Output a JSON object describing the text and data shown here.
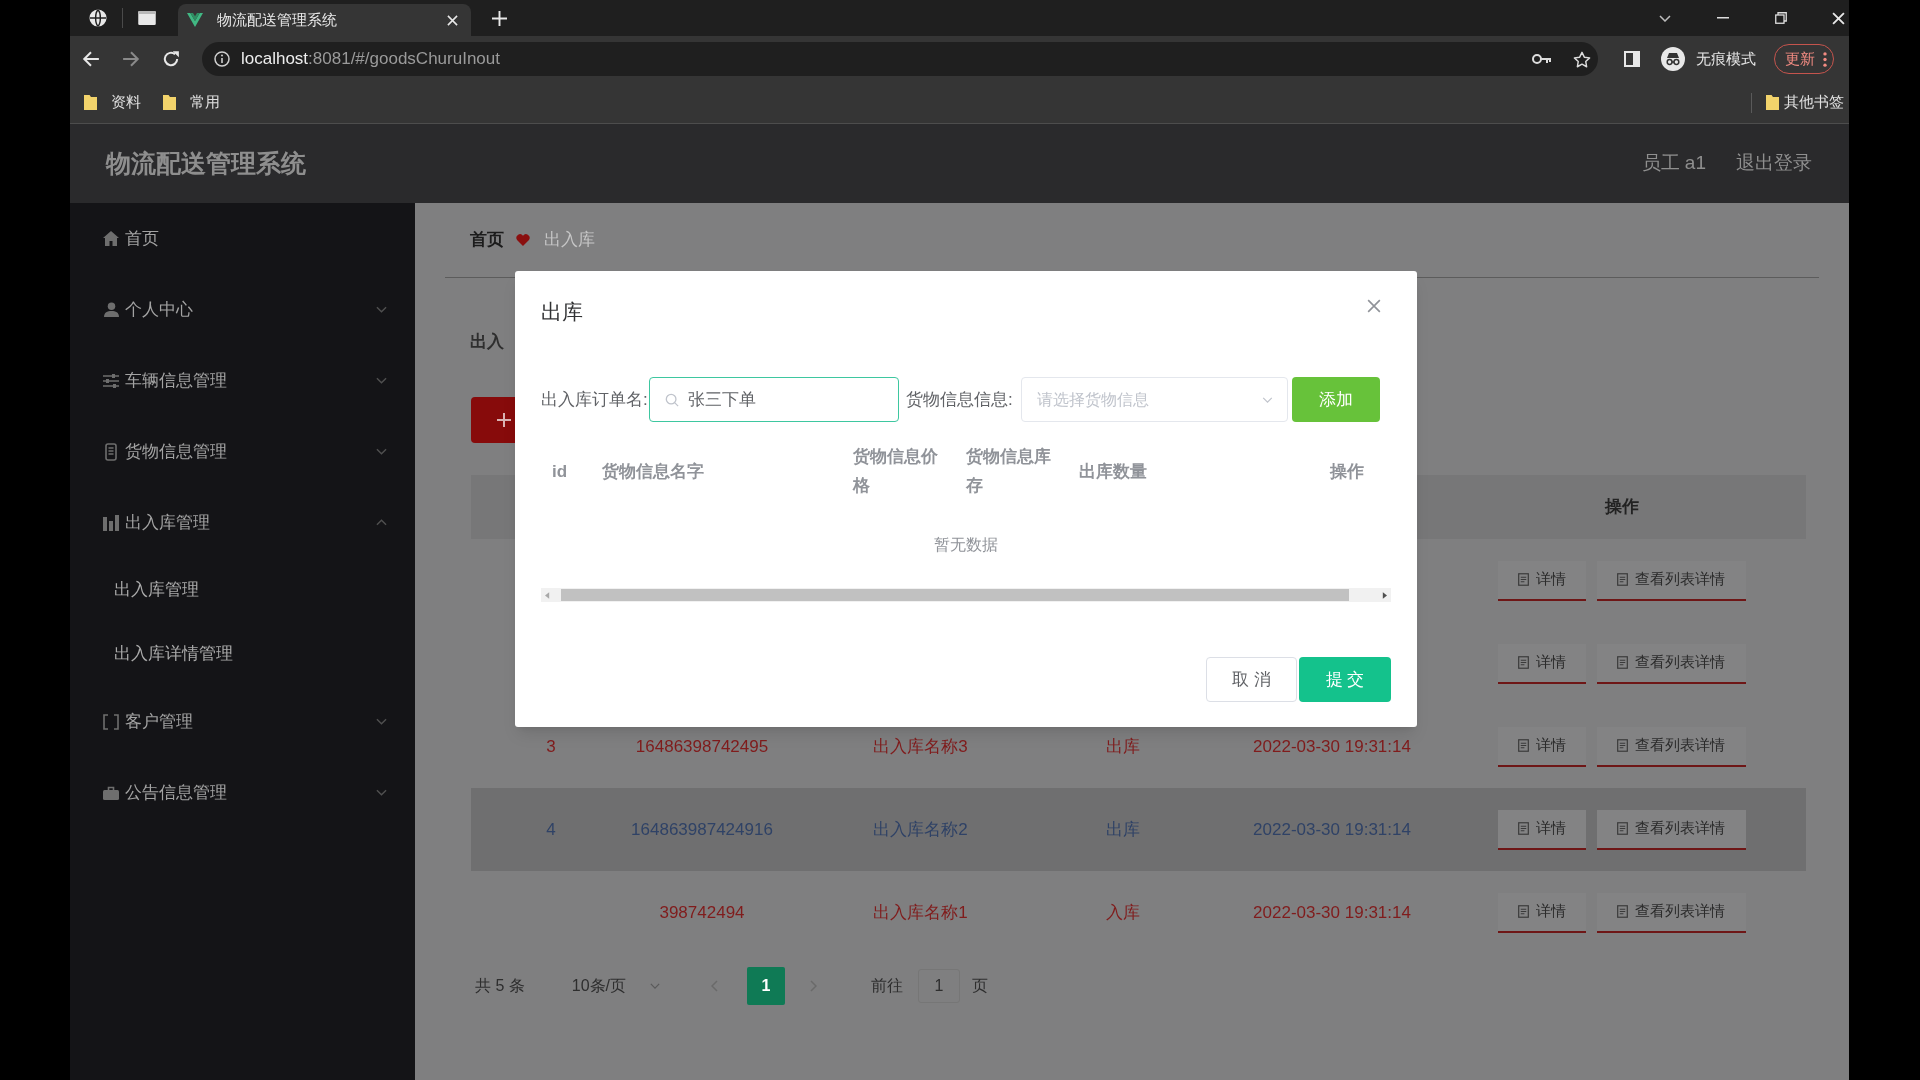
{
  "browser": {
    "tab_title": "物流配送管理系统",
    "url_host": "localhost",
    "url_path": ":8081/#/goodsChuruInout",
    "profile_label": "无痕模式",
    "update_label": "更新",
    "bookmarks": [
      "资料",
      "常用"
    ],
    "other_bookmarks": "其他书签"
  },
  "header": {
    "title": "物流配送管理系统",
    "user": "员工 a1",
    "logout": "退出登录"
  },
  "sidebar": {
    "items": [
      {
        "label": "首页",
        "kind": "link"
      },
      {
        "label": "个人中心",
        "kind": "group",
        "expanded": false
      },
      {
        "label": "车辆信息管理",
        "kind": "group",
        "expanded": false
      },
      {
        "label": "货物信息管理",
        "kind": "group",
        "expanded": false
      },
      {
        "label": "出入库管理",
        "kind": "group",
        "expanded": true,
        "children": [
          {
            "label": "出入库管理"
          },
          {
            "label": "出入库详情管理"
          }
        ]
      },
      {
        "label": "客户管理",
        "kind": "group",
        "expanded": false
      },
      {
        "label": "公告信息管理",
        "kind": "group",
        "expanded": false
      }
    ]
  },
  "breadcrumb": [
    "首页",
    "出入库"
  ],
  "search": {
    "label": "出入"
  },
  "table": {
    "action_header": "操作",
    "rows": [
      {
        "highlighted": false,
        "actions": [
          "详情",
          "查看列表详情"
        ]
      },
      {
        "highlighted": false,
        "actions": [
          "详情",
          "查看列表详情"
        ]
      },
      {
        "highlighted": false,
        "index": "3",
        "id": "16486398742495",
        "name": "出入库名称3",
        "type": "出库",
        "time": "2022-03-30 19:31:14",
        "actions": [
          "详情",
          "查看列表详情"
        ]
      },
      {
        "highlighted": true,
        "index": "4",
        "id": "164863987424916",
        "name": "出入库名称2",
        "type": "出库",
        "time": "2022-03-30 19:31:14",
        "actions": [
          "详情",
          "查看列表详情"
        ]
      },
      {
        "highlighted": false,
        "id": "398742494",
        "name": "出入库名称1",
        "type": "入库",
        "time": "2022-03-30 19:31:14",
        "actions": [
          "详情",
          "查看列表详情"
        ]
      }
    ]
  },
  "pagination": {
    "total": "共 5 条",
    "page_size": "10条/页",
    "pages": [
      {
        "label": "1",
        "selected": true
      }
    ],
    "jump_label": "前往",
    "jump_value": "1",
    "jump_suffix": "页"
  },
  "dialog": {
    "title": "出库",
    "order_label": "出入库订单名:",
    "order_value": "张三下单",
    "goods_label": "货物信息信息:",
    "goods_placeholder": "请选择货物信息",
    "add_button": "添加",
    "columns": [
      "id",
      "货物信息名字",
      "货物信息价格",
      "货物信息库存",
      "出库数量",
      "操作"
    ],
    "empty_text": "暂无数据",
    "buttons": [
      {
        "label": "取 消",
        "kind": "default"
      },
      {
        "label": "提 交",
        "kind": "primary"
      }
    ]
  }
}
